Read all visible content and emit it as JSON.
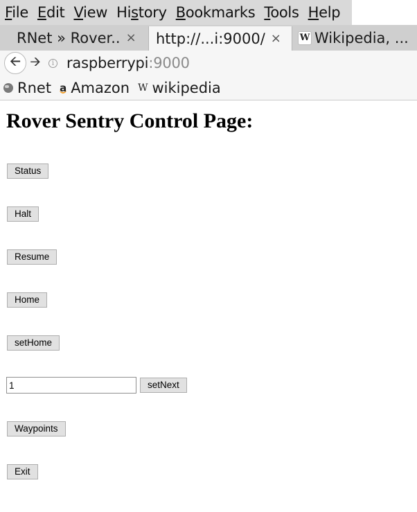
{
  "menubar": {
    "items": [
      {
        "accel": "F",
        "rest": "ile"
      },
      {
        "accel": "E",
        "rest": "dit"
      },
      {
        "accel": "V",
        "rest": "iew"
      },
      {
        "pre": "Hi",
        "accel": "s",
        "rest": "tory"
      },
      {
        "accel": "B",
        "rest": "ookmarks"
      },
      {
        "accel": "T",
        "rest": "ools"
      },
      {
        "accel": "H",
        "rest": "elp"
      }
    ]
  },
  "tabs": [
    {
      "title": "RNet » Rover..",
      "close": "×"
    },
    {
      "title": "http://...i:9000/",
      "close": "×"
    },
    {
      "title": "Wikipedia, ...",
      "favicon": "W"
    }
  ],
  "urlbar": {
    "host": "raspberrypi",
    "port": ":9000"
  },
  "bookmarks": [
    {
      "label": "Rnet",
      "icon": "globe-icon"
    },
    {
      "label": "Amazon",
      "icon": "amazon-icon",
      "glyph": "a"
    },
    {
      "label": "wikipedia",
      "icon": "wikipedia-icon",
      "glyph": "W"
    }
  ],
  "page": {
    "title": "Rover Sentry Control Page:",
    "buttons": {
      "status": "Status",
      "halt": "Halt",
      "resume": "Resume",
      "home": "Home",
      "sethome": "setHome",
      "setnext": "setNext",
      "waypoints": "Waypoints",
      "exit": "Exit"
    },
    "next_input_value": "1"
  }
}
